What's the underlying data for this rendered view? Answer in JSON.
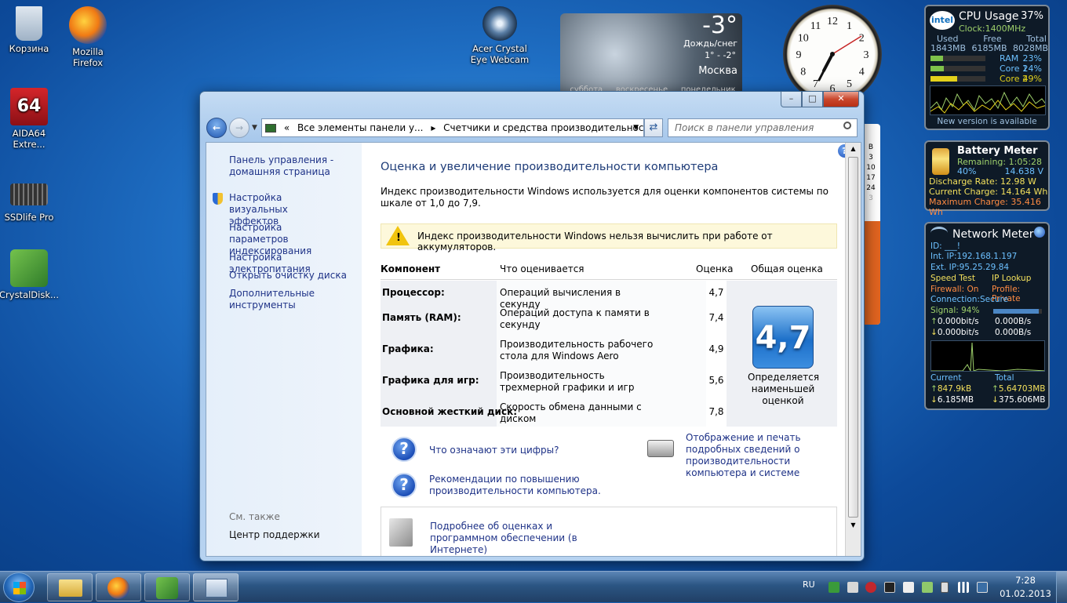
{
  "desktop": {
    "icons": [
      {
        "label": "Корзина",
        "icon": "recycle-bin-icon"
      },
      {
        "label": "Mozilla\nFirefox",
        "icon": "firefox-icon"
      },
      {
        "label": "AIDA64\nExtre...",
        "icon": "aida64-icon"
      },
      {
        "label": "SSDlife Pro",
        "icon": "ssdlife-icon"
      },
      {
        "label": "CrystalDisk...",
        "icon": "crystaldisk-icon"
      },
      {
        "label": "Acer Crystal\nEye Webcam",
        "icon": "webcam-icon"
      }
    ]
  },
  "weather": {
    "temp": "-3°",
    "condition": "Дождь/снег",
    "range": "1° - -2°",
    "city": "Москва",
    "days": [
      "суббота",
      "воскресенье",
      "понедельник"
    ]
  },
  "clock": {
    "numbers": [
      "12",
      "1",
      "2",
      "3",
      "4",
      "5",
      "6",
      "7",
      "8",
      "9",
      "10",
      "11"
    ]
  },
  "cpu": {
    "title": "CPU Usage",
    "value": "37%",
    "clock": "Clock:1400MHz",
    "h_used": "Used",
    "h_free": "Free",
    "h_total": "Total",
    "used": "1843MB",
    "free": "6185MB",
    "total": "8028MB",
    "rows": [
      {
        "label": "RAM",
        "value": "23%"
      },
      {
        "label": "Core 1",
        "value": "24%"
      },
      {
        "label": "Core 2",
        "value": "49%"
      }
    ],
    "footer": "New version is available"
  },
  "battery": {
    "title": "Battery Meter",
    "remaining": "Remaining: 1:05:28",
    "percent": "40%",
    "voltage": "14.638 V",
    "discharge": "Discharge Rate: 12.98 W",
    "current": "Current Charge: 14.164 Wh",
    "maximum": "Maximum Charge: 35.416 Wh"
  },
  "network": {
    "title": "Network Meter",
    "id": "ID: ___!",
    "int_ip": "Int. IP:192.168.1.197",
    "ext_ip": "Ext. IP:95.25.29.84",
    "speed_test": "Speed Test",
    "ip_lookup": "IP Lookup",
    "firewall": "Firewall: On",
    "profile": "Profile: Private",
    "connection": "Connection:Secure",
    "signal": "Signal: 94%",
    "up1": "0.000bit/s",
    "up2": "0.000B/s",
    "down1": "0.000bit/s",
    "down2": "0.000B/s",
    "current_label": "Current",
    "total_label": "Total",
    "cur_up": "847.9kB",
    "cur_down": "6.185MB",
    "tot_up": "5.64703MB",
    "tot_down": "375.606MB"
  },
  "window": {
    "address": {
      "crumb1": "Все элементы панели у...",
      "crumb2": "Счетчики и средства производительности"
    },
    "search_placeholder": "Поиск в панели управления",
    "sidebar": {
      "home": "Панель управления - домашняя страница",
      "links": [
        "Настройка визуальных эффектов",
        "Настройка параметров индексирования",
        "Настройка электропитания",
        "Открыть очистку диска",
        "Дополнительные инструменты"
      ],
      "see_also": "См. также",
      "support": "Центр поддержки"
    },
    "title": "Оценка и увеличение производительности компьютера",
    "description": "Индекс производительности Windows используется для оценки компонентов системы по шкале от 1,0 до 7,9.",
    "warning": "Индекс производительности Windows нельзя вычислить при работе от аккумуляторов.",
    "table": {
      "headers": {
        "component": "Компонент",
        "rated": "Что оценивается",
        "score": "Оценка",
        "base": "Общая оценка"
      },
      "rows": [
        {
          "component": "Процессор:",
          "rated": "Операций вычисления в секунду",
          "score": "4,7"
        },
        {
          "component": "Память (RAM):",
          "rated": "Операций доступа к памяти в секунду",
          "score": "7,4"
        },
        {
          "component": "Графика:",
          "rated": "Производительность рабочего стола для Windows Aero",
          "score": "4,9"
        },
        {
          "component": "Графика для игр:",
          "rated": "Производительность трехмерной графики и игр",
          "score": "5,6"
        },
        {
          "component": "Основной жесткий диск:",
          "rated": "Скорость обмена данными с диском",
          "score": "7,8"
        }
      ],
      "base_score": "4,7",
      "base_note": "Определяется наименьшей оценкой"
    },
    "links": {
      "what_numbers": "Что означают эти цифры?",
      "print": "Отображение и печать подробных сведений о производительности компьютера и системе",
      "tips": "Рекомендации по повышению производительности компьютера.",
      "more": "Подробнее об оценках и программном обеспечении (в Интернете)"
    }
  },
  "calendar_strip": [
    "B",
    "3",
    "10",
    "17",
    "24",
    "3"
  ],
  "taskbar": {
    "lang": "RU",
    "time": "7:28",
    "date": "01.02.2013"
  }
}
